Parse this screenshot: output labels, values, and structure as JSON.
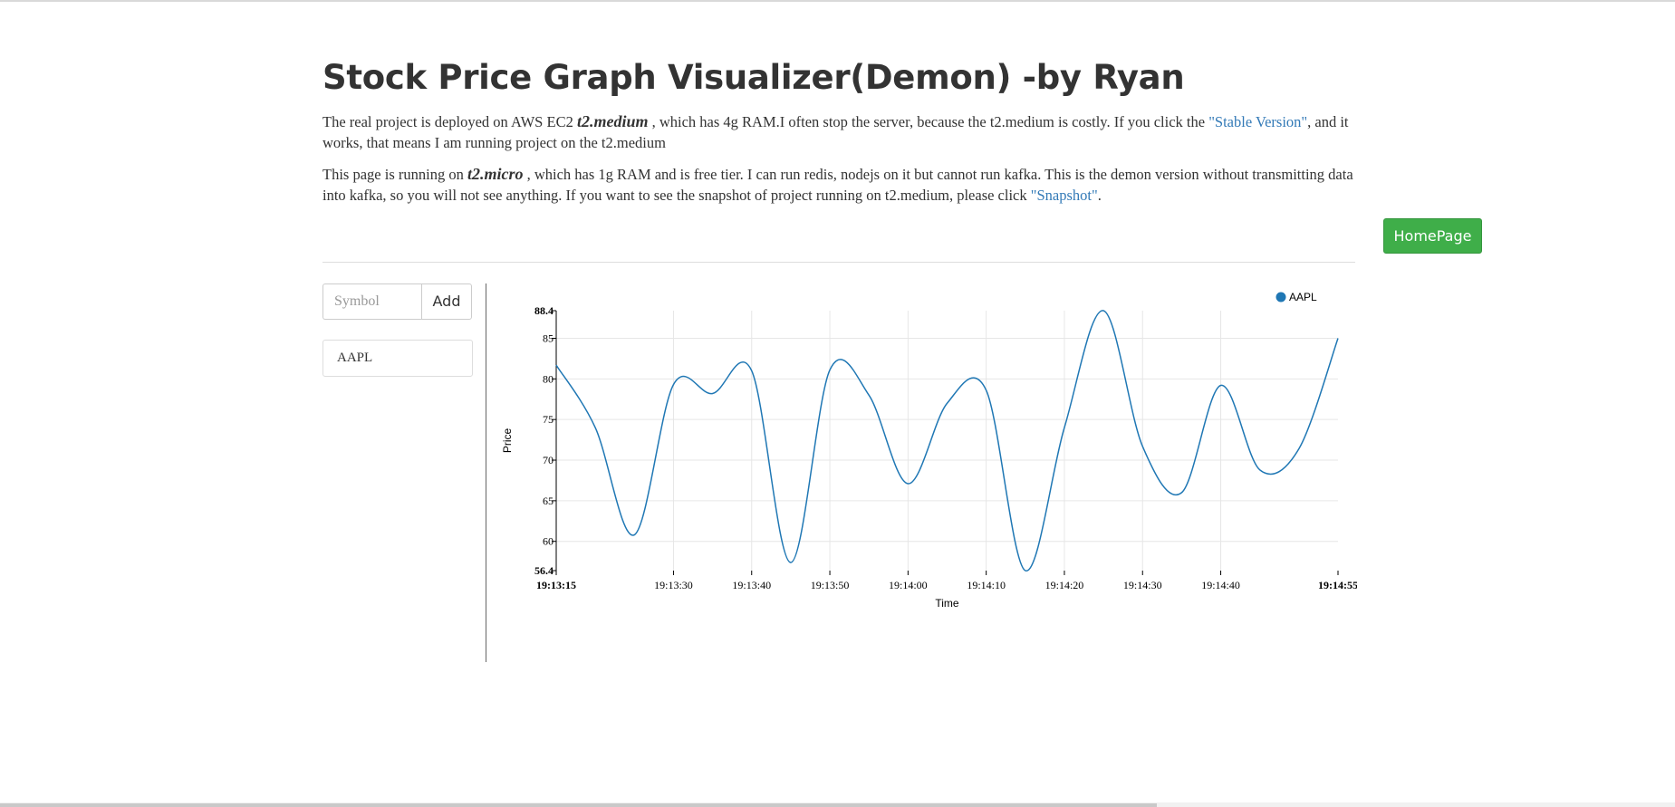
{
  "header": {
    "title": "Stock Price Graph Visualizer(Demon) -by Ryan"
  },
  "intro": {
    "p1_pre": "The real project is deployed on AWS EC2 ",
    "p1_bold": "t2.medium",
    "p1_mid": " , which has 4g RAM.I often stop the server, because the t2.medium is costly. If you click the ",
    "p1_link": "\"Stable Version\"",
    "p1_post": ", and it works, that means I am running project on the t2.medium",
    "p2_pre": "This page is running on ",
    "p2_bold": "t2.micro",
    "p2_mid": " , which has 1g RAM and is free tier. I can run redis, nodejs on it but cannot run kafka. This is the demon version without transmitting data into kafka, so you will not see anything. If you want to see the snapshot of project running on t2.medium, please click ",
    "p2_link": "\"Snapshot\"",
    "p2_post": "."
  },
  "homepage_button": "HomePage",
  "symbol_form": {
    "placeholder": "Symbol",
    "value": "",
    "add_label": "Add"
  },
  "stock_list": [
    "AAPL"
  ],
  "colors": {
    "series": "#1f77b4",
    "homepage_button": "#3fae49",
    "link": "#337ab7"
  },
  "chart_data": {
    "type": "line",
    "title": "",
    "xlabel": "Time",
    "ylabel": "Price",
    "legend_position": "top-right",
    "grid": true,
    "ylim": [
      56.4,
      88.4
    ],
    "y_ticks": [
      "56.4",
      "60",
      "65",
      "70",
      "75",
      "80",
      "85",
      "88.4"
    ],
    "x_range": [
      "19:13:15",
      "19:14:55"
    ],
    "x_ticks": [
      "19:13:15",
      "19:13:30",
      "19:13:40",
      "19:13:50",
      "19:14:00",
      "19:14:10",
      "19:14:20",
      "19:14:30",
      "19:14:40",
      "19:14:55"
    ],
    "series": [
      {
        "name": "AAPL",
        "points": [
          [
            "19:13:15",
            81.7
          ],
          [
            "19:13:20",
            74.0
          ],
          [
            "19:13:25",
            60.8
          ],
          [
            "19:13:30",
            79.3
          ],
          [
            "19:13:35",
            78.2
          ],
          [
            "19:13:40",
            81.0
          ],
          [
            "19:13:45",
            57.4
          ],
          [
            "19:13:50",
            81.1
          ],
          [
            "19:13:55",
            78.0
          ],
          [
            "19:14:00",
            67.1
          ],
          [
            "19:14:05",
            77.0
          ],
          [
            "19:14:10",
            78.6
          ],
          [
            "19:14:15",
            56.4
          ],
          [
            "19:14:20",
            74.0
          ],
          [
            "19:14:25",
            88.4
          ],
          [
            "19:14:30",
            71.7
          ],
          [
            "19:14:35",
            66.0
          ],
          [
            "19:14:40",
            79.2
          ],
          [
            "19:14:45",
            68.8
          ],
          [
            "19:14:50",
            71.4
          ],
          [
            "19:14:55",
            85.0
          ]
        ]
      }
    ]
  }
}
